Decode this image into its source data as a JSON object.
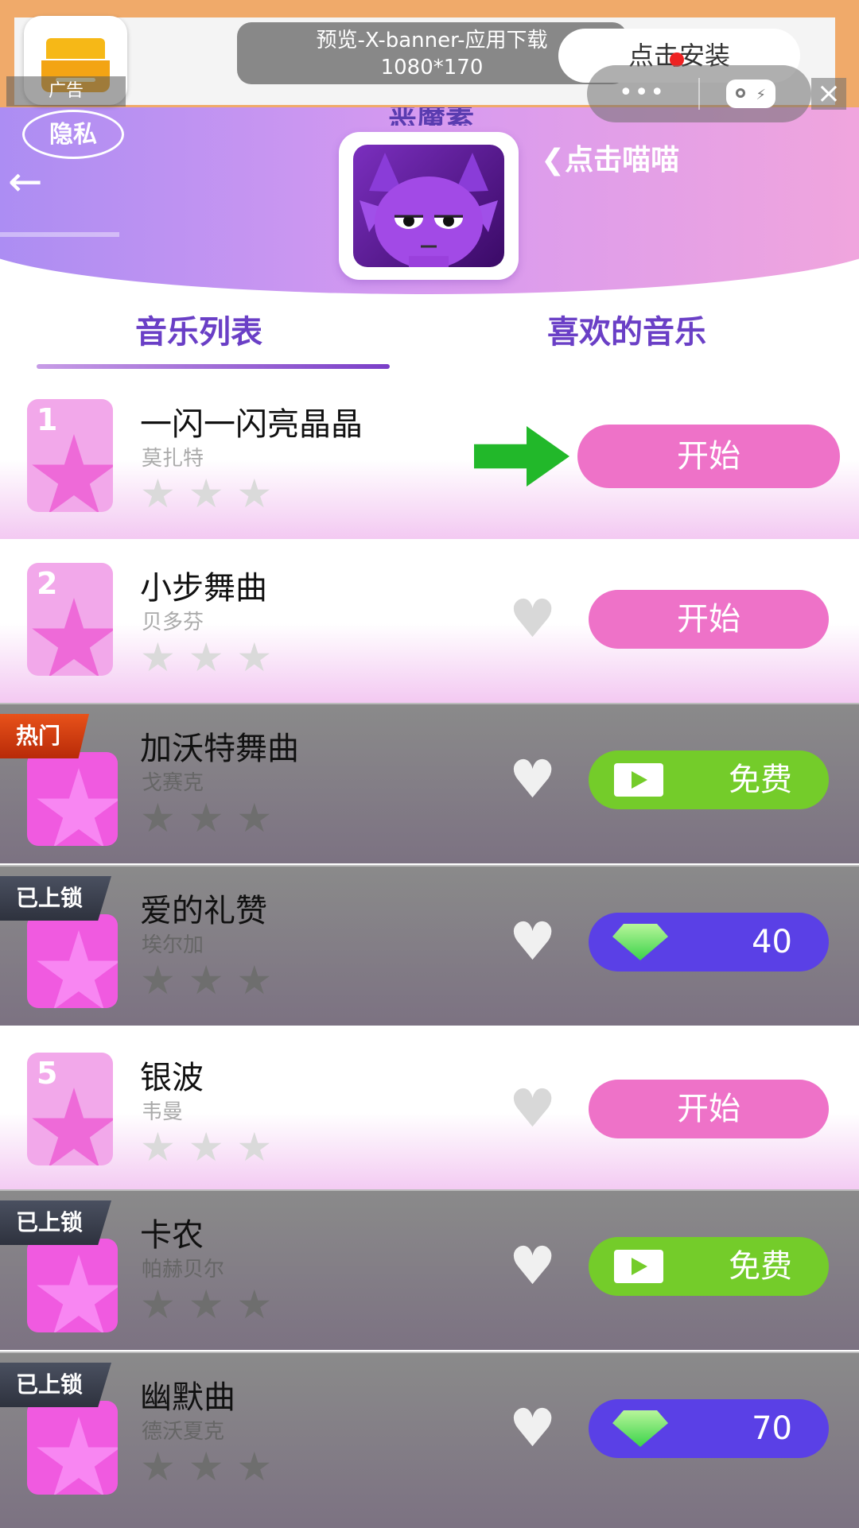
{
  "ad": {
    "label": "广告",
    "preview_line1": "预览-X-banner-应用下载",
    "preview_line2": "1080*170",
    "install": "点击安装",
    "more": "•••",
    "close": "×"
  },
  "header": {
    "title": "恶魔素",
    "privacy": "隐私",
    "back": "←",
    "meow": "❮点击喵喵"
  },
  "tabs": [
    {
      "label": "音乐列表",
      "active": true
    },
    {
      "label": "喜欢的音乐",
      "active": false
    }
  ],
  "songs": [
    {
      "num": "1",
      "title": "一闪一闪亮晶晶",
      "artist": "莫扎特",
      "stars": "★ ★ ★",
      "action": "开始",
      "locked": false
    },
    {
      "num": "2",
      "title": "小步舞曲",
      "artist": "贝多芬",
      "stars": "★ ★ ★",
      "action": "开始",
      "locked": false
    },
    {
      "badge": "热门",
      "title": "加沃特舞曲",
      "artist": "戈赛克",
      "stars": "★ ★ ★",
      "action": "免费",
      "locked": true
    },
    {
      "badge": "已上锁",
      "title": "爱的礼赞",
      "artist": "埃尔加",
      "stars": "★ ★ ★",
      "action": "40",
      "locked": true
    },
    {
      "num": "5",
      "title": "银波",
      "artist": "韦曼",
      "stars": "★ ★ ★",
      "action": "开始",
      "locked": false
    },
    {
      "badge": "已上锁",
      "title": "卡农",
      "artist": "帕赫贝尔",
      "stars": "★ ★ ★",
      "action": "免费",
      "locked": true
    },
    {
      "badge": "已上锁",
      "title": "幽默曲",
      "artist": "德沃夏克",
      "stars": "★ ★ ★",
      "action": "70",
      "locked": true
    }
  ],
  "icons": {
    "heart": "♥",
    "star": "★"
  },
  "colors": {
    "start_button": "#ee72c8",
    "free_button": "#74cc2a",
    "gem_button": "#5a40e6",
    "tab_active": "#6a3fc6"
  }
}
